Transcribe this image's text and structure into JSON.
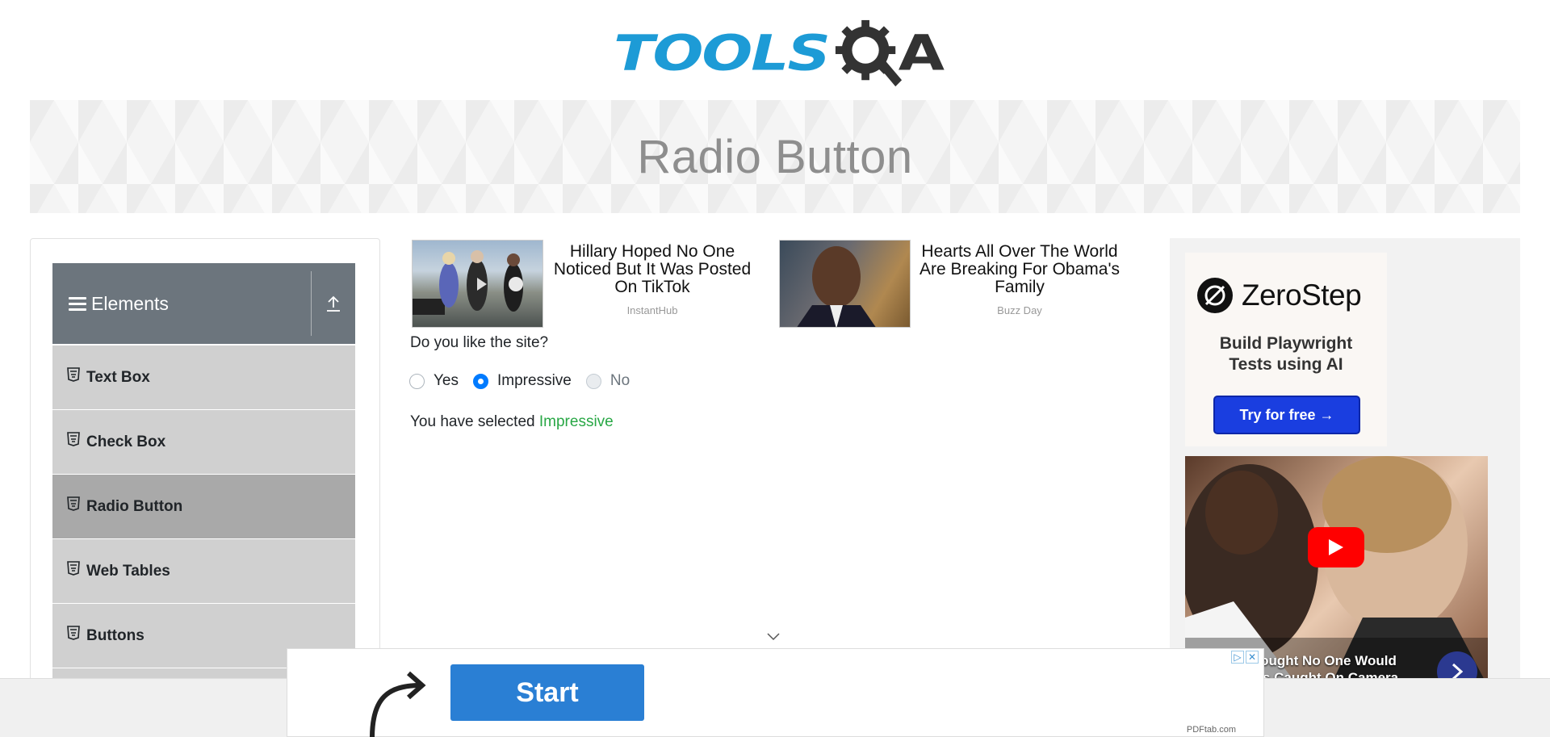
{
  "header": {
    "logo_text": "TOOLSQA",
    "logo_primary": "TOOLS",
    "logo_secondary": "A"
  },
  "banner": {
    "title": "Radio Button"
  },
  "sidebar": {
    "group_title": "Elements",
    "items": [
      {
        "label": "Text Box"
      },
      {
        "label": "Check Box"
      },
      {
        "label": "Radio Button",
        "active": true
      },
      {
        "label": "Web Tables"
      },
      {
        "label": "Buttons"
      }
    ]
  },
  "ads": [
    {
      "headline": "Hillary Hoped No One Noticed But It Was Posted On TikTok",
      "source": "InstantHub"
    },
    {
      "headline": "Hearts All Over The World Are Breaking For Obama's Family",
      "source": "Buzz Day"
    }
  ],
  "main": {
    "question": "Do you like the site?",
    "options": [
      {
        "label": "Yes",
        "checked": false,
        "disabled": false
      },
      {
        "label": "Impressive",
        "checked": true,
        "disabled": false
      },
      {
        "label": "No",
        "checked": false,
        "disabled": true
      }
    ],
    "result_prefix": "You have selected ",
    "result_value": "Impressive"
  },
  "right_ad": {
    "brand": "ZeroStep",
    "tagline_line1": "Build Playwright",
    "tagline_line2": "Tests using AI",
    "cta": "Try for free →",
    "video_caption_line1": "Obama Thought No One Would",
    "video_caption_line2": "It Was Caught On Camera"
  },
  "bottom_ad": {
    "button": "Start",
    "domain": "PDFtab.com",
    "close_labels": [
      "▷",
      "✕"
    ]
  },
  "colors": {
    "accent": "#007bff",
    "success": "#28a745",
    "sidebar_header": "#6c757d",
    "logo_blue": "#1d9bd6"
  }
}
